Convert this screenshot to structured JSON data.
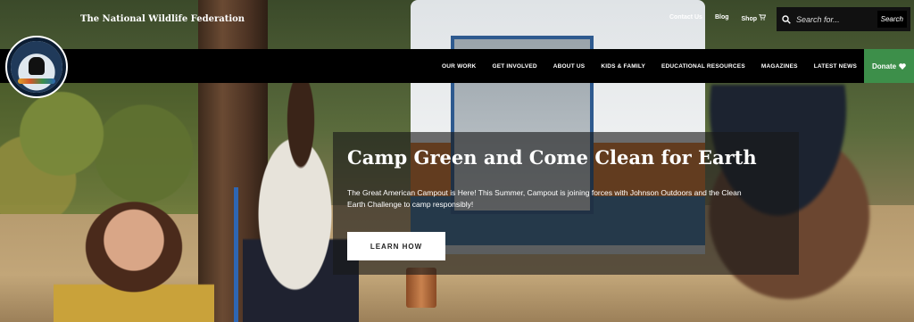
{
  "header": {
    "brand": "The National Wildlife Federation",
    "utility_links": [
      "Contact Us",
      "Blog",
      "Shop"
    ],
    "search": {
      "placeholder": "Search for...",
      "button": "Search"
    }
  },
  "nav": {
    "items": [
      "OUR WORK",
      "GET INVOLVED",
      "ABOUT US",
      "KIDS & FAMILY",
      "EDUCATIONAL RESOURCES",
      "MAGAZINES",
      "LATEST NEWS"
    ],
    "donate": "Donate",
    "donate_color": "#3d8f4a"
  },
  "logo": {
    "name": "national-wildlife-federation-logo",
    "text": "NATIONAL WILDLIFE FEDERATION"
  },
  "hero": {
    "title": "Camp Green and Come Clean for Earth",
    "description": "The Great American Campout is Here! This Summer, Campout is joining forces with Johnson Outdoors and the Clean Earth Challenge to camp responsibly!",
    "cta": "LEARN HOW"
  }
}
